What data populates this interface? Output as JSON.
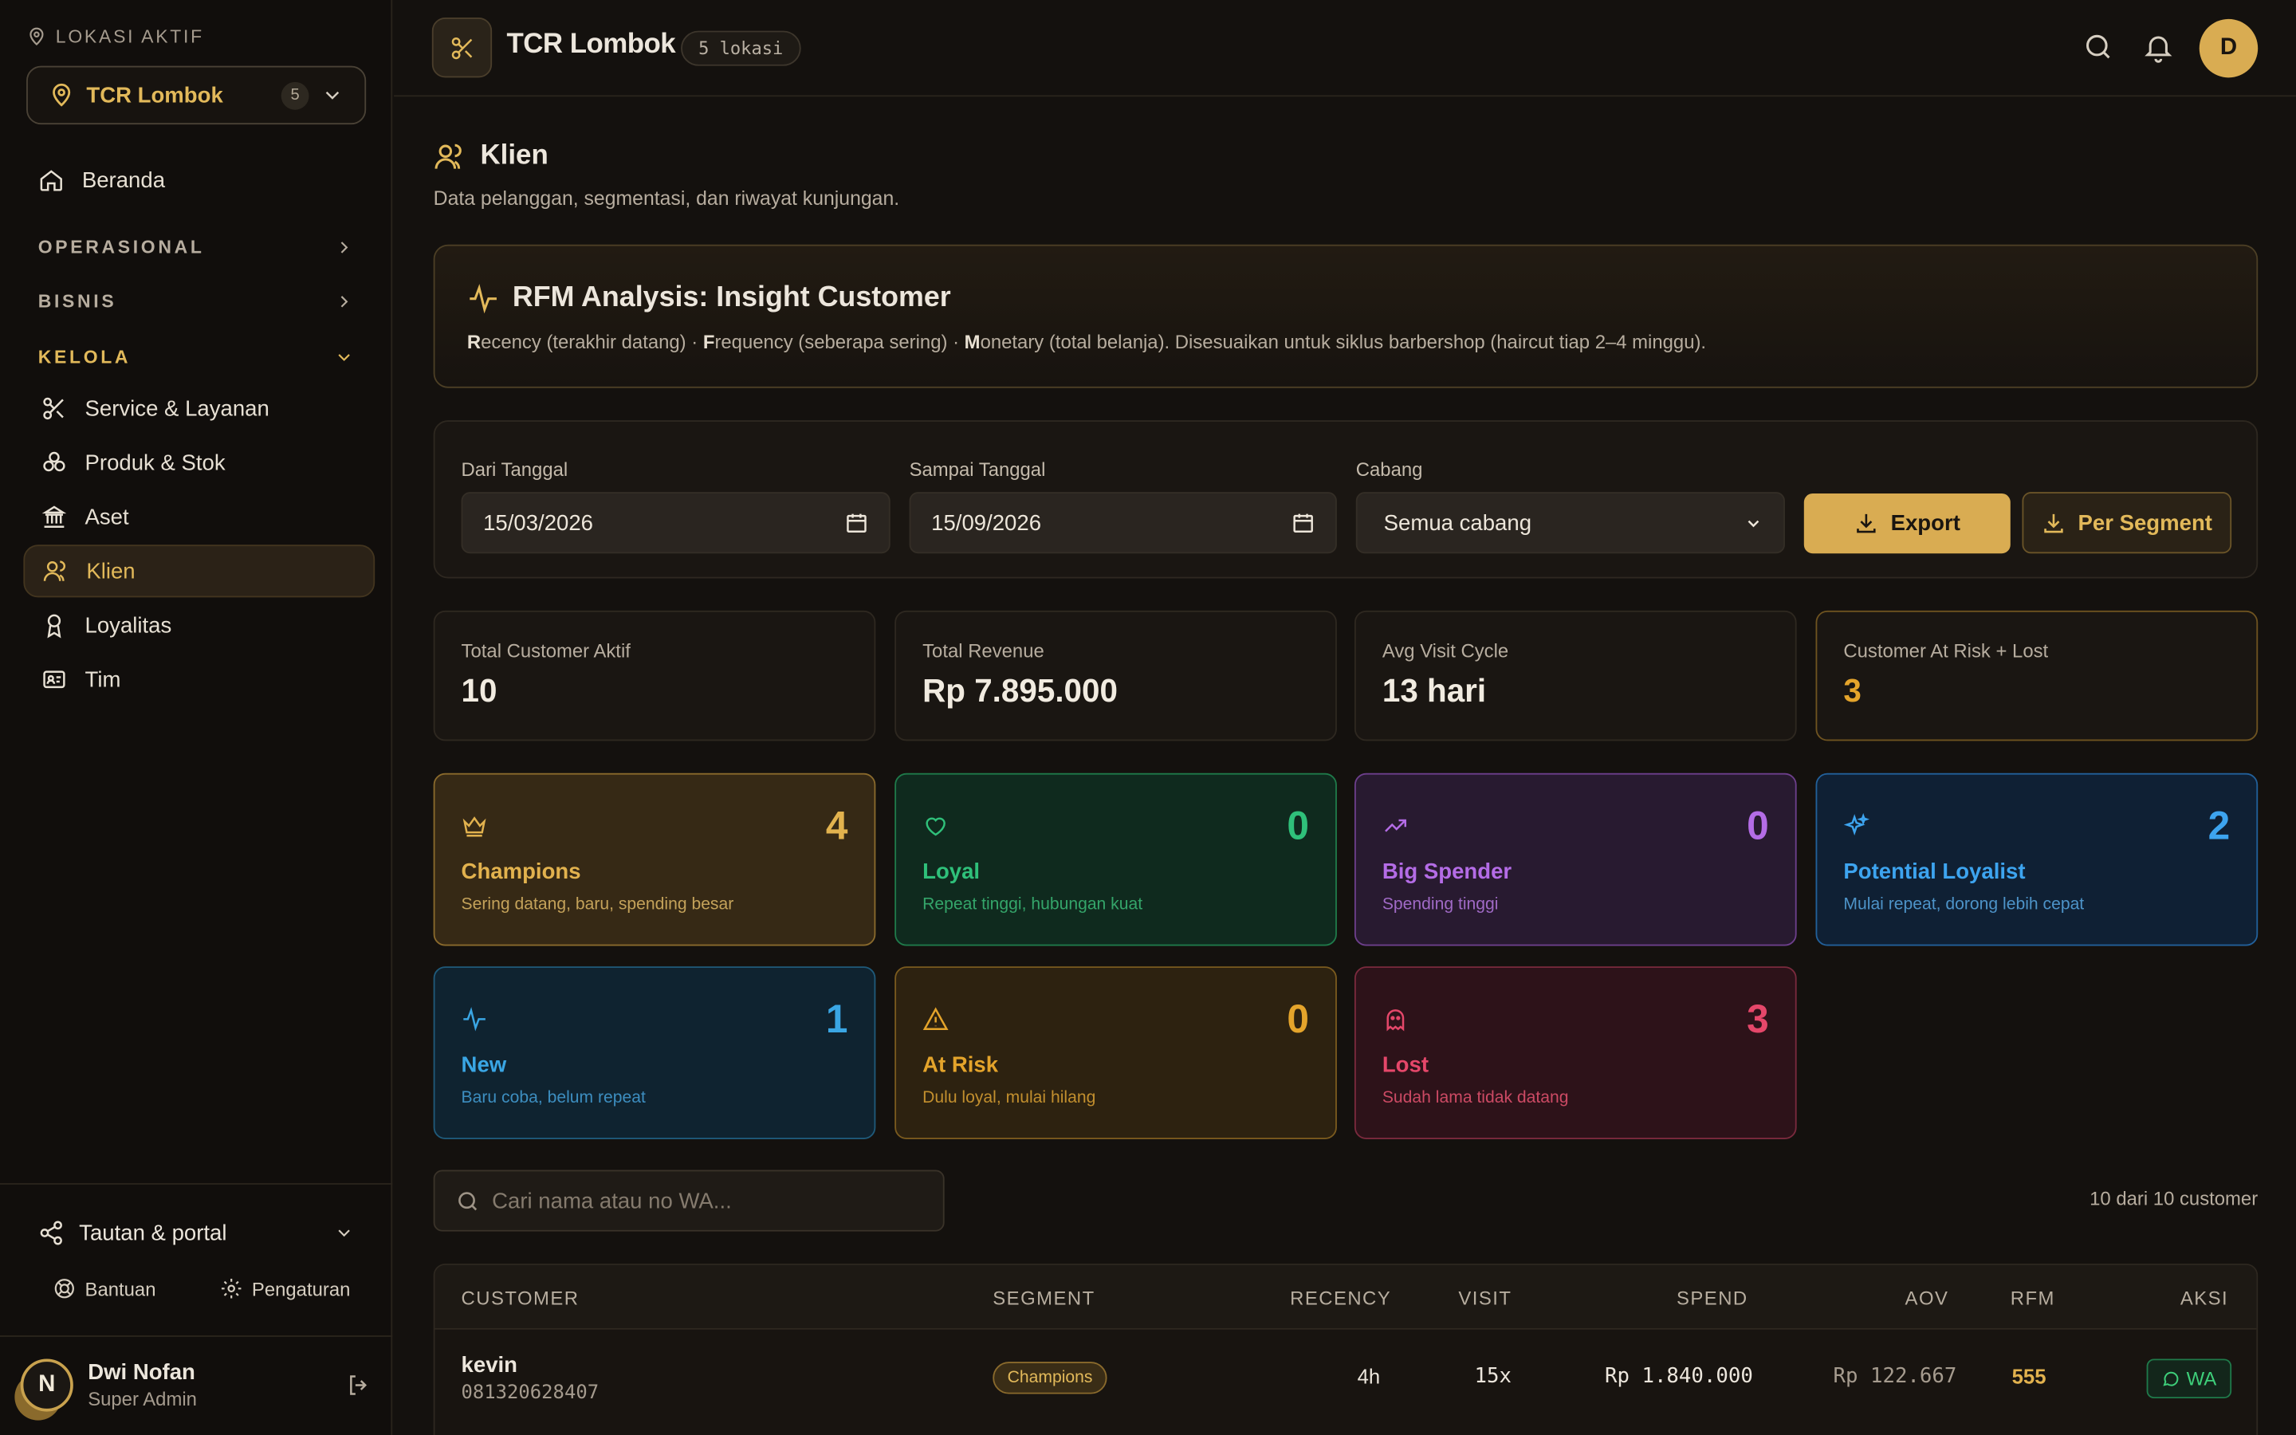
{
  "sidebar": {
    "location_caption": "LOKASI AKTIF",
    "location_name": "TCR Lombok",
    "location_count": "5",
    "home": "Beranda",
    "groups": {
      "operasional": "OPERASIONAL",
      "bisnis": "BISNIS",
      "kelola": "KELOLA"
    },
    "items": [
      {
        "label": "Service & Layanan",
        "icon": "scissors-icon"
      },
      {
        "label": "Produk & Stok",
        "icon": "boxes-icon"
      },
      {
        "label": "Aset",
        "icon": "bank-icon"
      },
      {
        "label": "Klien",
        "icon": "users-icon"
      },
      {
        "label": "Loyalitas",
        "icon": "award-icon"
      },
      {
        "label": "Tim",
        "icon": "id-card-icon"
      }
    ],
    "active": "Klien",
    "portal": "Tautan & portal",
    "help": "Bantuan",
    "settings": "Pengaturan",
    "user": {
      "initial": "N",
      "name": "Dwi Nofan",
      "role": "Super Admin"
    }
  },
  "header": {
    "brand": "TCR Lombok",
    "badge": "5 lokasi",
    "avatar_initial": "D"
  },
  "page": {
    "title": "Klien",
    "subtitle": "Data pelanggan, segmentasi, dan riwayat kunjungan."
  },
  "rfm": {
    "title": "RFM Analysis: Insight Customer",
    "r_letter": "R",
    "r_rest": "ecency (terakhir datang) · ",
    "f_letter": "F",
    "f_rest": "requency (seberapa sering) · ",
    "m_letter": "M",
    "m_rest": "onetary (total belanja). Disesuaikan untuk siklus barbershop (haircut tiap 2–4 minggu)."
  },
  "filters": {
    "from_label": "Dari Tanggal",
    "from_value": "15/03/2026",
    "to_label": "Sampai Tanggal",
    "to_value": "15/09/2026",
    "branch_label": "Cabang",
    "branch_value": "Semua cabang",
    "export_label": "Export",
    "segment_label": "Per Segment"
  },
  "stats": [
    {
      "label": "Total Customer Aktif",
      "value": "10"
    },
    {
      "label": "Total Revenue",
      "value": "Rp 7.895.000"
    },
    {
      "label": "Avg Visit Cycle",
      "value": "13 hari"
    },
    {
      "label": "Customer At Risk + Lost",
      "value": "3"
    }
  ],
  "segments": [
    {
      "name": "Champions",
      "desc": "Sering datang, baru, spending besar",
      "count": "4",
      "icon": "crown-icon",
      "color": "#e2b24e"
    },
    {
      "name": "Loyal",
      "desc": "Repeat tinggi, hubungan kuat",
      "count": "0",
      "icon": "heart-icon",
      "color": "#2fc07a"
    },
    {
      "name": "Big Spender",
      "desc": "Spending tinggi",
      "count": "0",
      "icon": "trending-up-icon",
      "color": "#b46ce6"
    },
    {
      "name": "Potential Loyalist",
      "desc": "Mulai repeat, dorong lebih cepat",
      "count": "2",
      "icon": "sparkles-icon",
      "color": "#3da4ef"
    },
    {
      "name": "New",
      "desc": "Baru coba, belum repeat",
      "count": "1",
      "icon": "activity-icon",
      "color": "#3aa6e4"
    },
    {
      "name": "At Risk",
      "desc": "Dulu loyal, mulai hilang",
      "count": "0",
      "icon": "alert-triangle-icon",
      "color": "#e4a42b"
    },
    {
      "name": "Lost",
      "desc": "Sudah lama tidak datang",
      "count": "3",
      "icon": "ghost-icon",
      "color": "#e5476a"
    }
  ],
  "search": {
    "placeholder": "Cari nama atau no WA...",
    "count_text": "10 dari 10 customer"
  },
  "table": {
    "columns": [
      "CUSTOMER",
      "SEGMENT",
      "RECENCY",
      "VISIT",
      "SPEND",
      "AOV",
      "RFM",
      "AKSI"
    ],
    "rows": [
      {
        "name": "kevin",
        "phone": "081320628407",
        "segment": "Champions",
        "recency": "4h",
        "visit": "15x",
        "spend": "Rp 1.840.000",
        "aov": "Rp 122.667",
        "rfm": "555",
        "action": "WA"
      }
    ]
  }
}
